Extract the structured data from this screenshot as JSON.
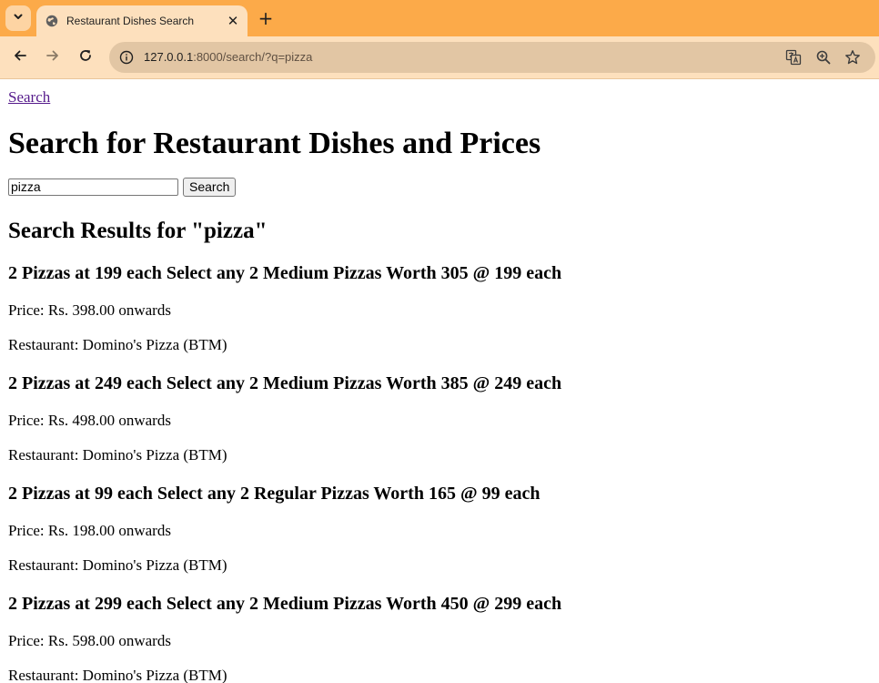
{
  "browser": {
    "tab": {
      "title": "Restaurant Dishes Search",
      "favicon": "globe-icon"
    },
    "address_bar": {
      "host": "127.0.0.1",
      "path": ":8000/search/?q=pizza"
    },
    "icons": {
      "tab_menu": "chevron-down-icon",
      "close": "close-icon",
      "new_tab": "plus-icon",
      "back": "arrow-left-icon",
      "forward": "arrow-right-icon",
      "reload": "reload-icon",
      "site_info": "info-icon",
      "translate": "translate-icon",
      "zoom": "zoom-icon",
      "bookmark": "star-icon"
    },
    "colors": {
      "tabstrip": "#fcaa49",
      "toolbar": "#fde0bd",
      "omnibox": "#e2c6a4",
      "visited_link": "#551a8b"
    }
  },
  "page": {
    "nav_link": "Search",
    "title": "Search for Restaurant Dishes and Prices",
    "search": {
      "value": "pizza",
      "button_label": "Search"
    },
    "results_heading": "Search Results for \"pizza\"",
    "results": [
      {
        "name": "2 Pizzas at 199 each Select any 2 Medium Pizzas Worth 305 @ 199 each",
        "price": "Price: Rs. 398.00 onwards",
        "restaurant": "Restaurant: Domino's Pizza (BTM)"
      },
      {
        "name": "2 Pizzas at 249 each Select any 2 Medium Pizzas Worth 385 @ 249 each",
        "price": "Price: Rs. 498.00 onwards",
        "restaurant": "Restaurant: Domino's Pizza (BTM)"
      },
      {
        "name": "2 Pizzas at 99 each Select any 2 Regular Pizzas Worth 165 @ 99 each",
        "price": "Price: Rs. 198.00 onwards",
        "restaurant": "Restaurant: Domino's Pizza (BTM)"
      },
      {
        "name": "2 Pizzas at 299 each Select any 2 Medium Pizzas Worth 450 @ 299 each",
        "price": "Price: Rs. 598.00 onwards",
        "restaurant": "Restaurant: Domino's Pizza (BTM)"
      }
    ]
  }
}
